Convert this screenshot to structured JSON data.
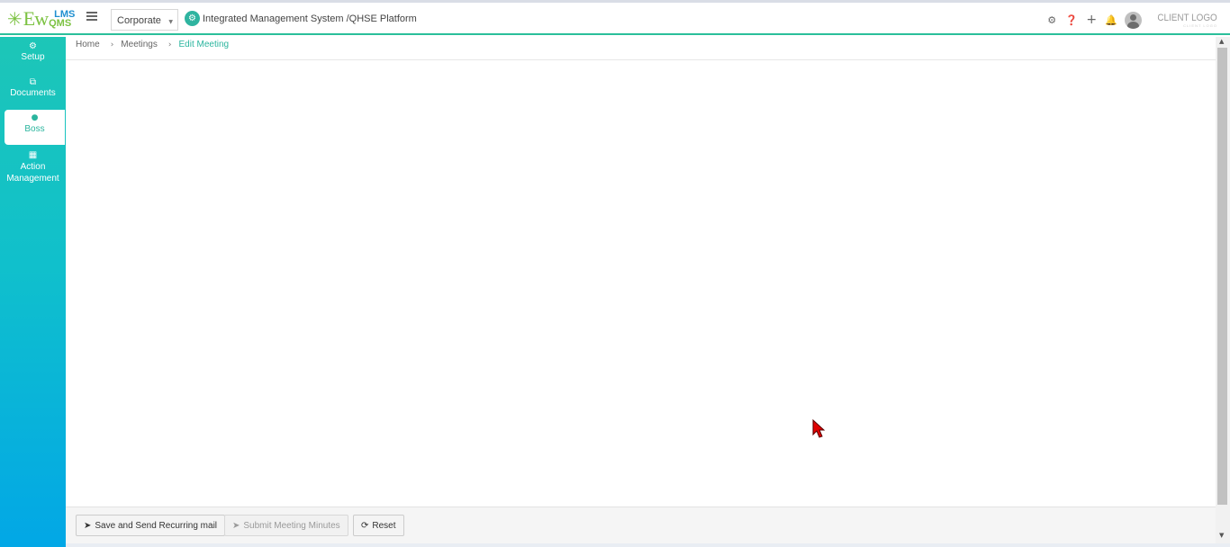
{
  "header": {
    "logo": {
      "ew": "Ew",
      "lms": "LMS",
      "qms": "QMS"
    },
    "company_select": "Corporate",
    "platform_title": "Integrated Management System /QHSE Platform",
    "icons": [
      "gear-icon",
      "help-icon",
      "plus-icon",
      "bell-icon",
      "user-avatar"
    ],
    "client_logo": "CLIENT LOGO",
    "client_logo_sub": "CLIENT LOGO"
  },
  "sidebar": {
    "items": [
      {
        "label": "Setup",
        "icon": "cogs-icon",
        "glyph": "⚙"
      },
      {
        "label": "Documents",
        "icon": "documents-icon",
        "glyph": "⧉"
      },
      {
        "label": "Boss",
        "icon": "user-icon",
        "glyph": "👤",
        "active": true
      },
      {
        "label": "Action Management",
        "icon": "building-icon",
        "glyph": "▦"
      }
    ]
  },
  "breadcrumb": {
    "home": "Home",
    "meetings": "Meetings",
    "current": "Edit Meeting"
  },
  "footer": {
    "save_label": "Save and Send Recurring mail",
    "submit_label": "Submit Meeting Minutes",
    "reset_label": "Reset"
  },
  "colors": {
    "accent": "#2bb59e",
    "sidebar_top": "#1dc6b7",
    "sidebar_bottom": "#02a7e6",
    "cursor": "#e00000"
  }
}
